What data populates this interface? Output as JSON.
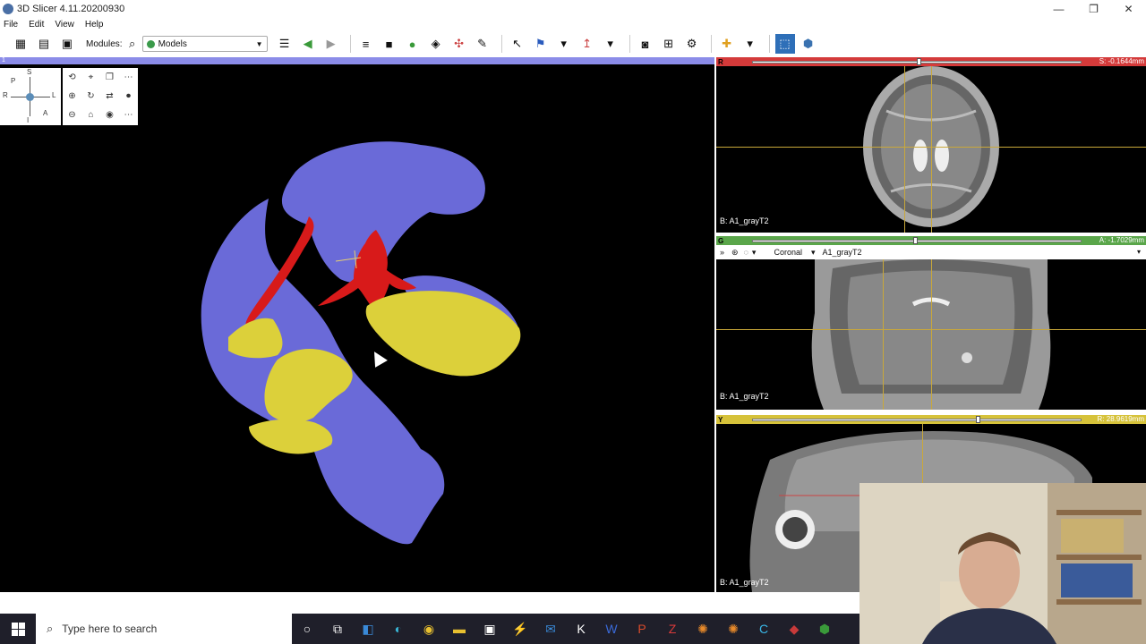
{
  "window": {
    "title": "3D Slicer 4.11.20200930"
  },
  "menu": {
    "file": "File",
    "edit": "Edit",
    "view": "View",
    "help": "Help"
  },
  "toolbar": {
    "modules_label": "Modules:",
    "module_selected": "Models"
  },
  "view3d": {
    "layout_number": "1",
    "orientation": {
      "s": "S",
      "p": "P",
      "r": "R",
      "l": "L",
      "a": "A",
      "i": "I"
    }
  },
  "red_slice": {
    "code": "R",
    "offset": "S: -0.1644mm",
    "label": "B: A1_grayT2",
    "slider_fraction": 0.5,
    "color": "#d43a3a"
  },
  "green_slice": {
    "code": "G",
    "offset": "A: -1.7029mm",
    "label": "B: A1_grayT2",
    "slider_fraction": 0.49,
    "orientation": "Coronal",
    "volume": "A1_grayT2",
    "color": "#5aa64a"
  },
  "yellow_slice": {
    "code": "Y",
    "offset": "R: 28.9619mm",
    "label": "B: A1_grayT2",
    "slider_fraction": 0.68,
    "color": "#d6c23a"
  },
  "taskbar": {
    "search_placeholder": "Type here to search"
  },
  "colors": {
    "blue_model": "#6a6ad8",
    "red_model": "#d81a1a",
    "yellow_model": "#dcd03a"
  }
}
